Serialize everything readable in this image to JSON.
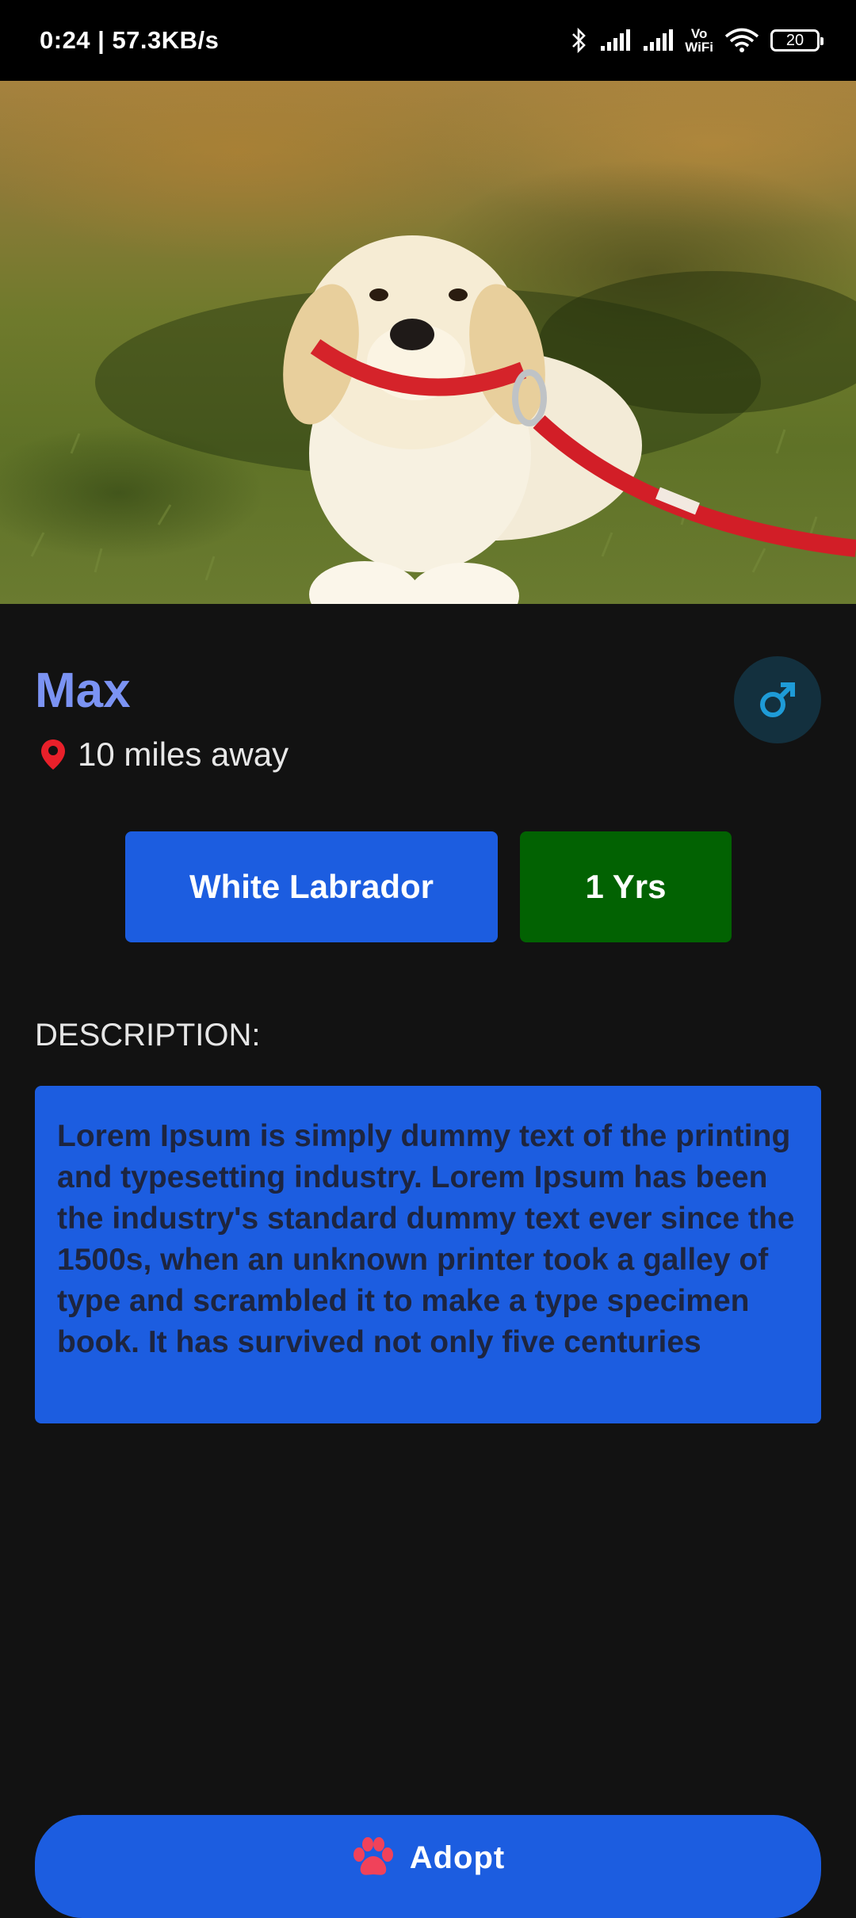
{
  "status_bar": {
    "time": "0:24 | 57.3KB/s",
    "vowifi_top": "Vo",
    "vowifi_bottom": "WiFi",
    "battery": "20"
  },
  "hero": {
    "image": "puppy-photo"
  },
  "pet": {
    "name": "Max",
    "distance": "10 miles away",
    "gender_icon": "male-icon"
  },
  "chips": {
    "breed": "White Labrador",
    "age": "1 Yrs"
  },
  "description": {
    "label": "DESCRIPTION:",
    "text": "Lorem Ipsum is simply dummy text of the printing and typesetting industry. Lorem Ipsum has been the industry's standard dummy text ever since the 1500s, when an unknown printer took a galley of type and scrambled it to make a type specimen book. It has survived not only five centuries"
  },
  "actions": {
    "adopt_label": "Adopt"
  },
  "colors": {
    "background": "#121212",
    "accent_blue": "#1c5de0",
    "name_color": "#7b93f3",
    "age_green": "#026202",
    "paw_red": "#f0425a",
    "pin_red": "#e8202a"
  }
}
